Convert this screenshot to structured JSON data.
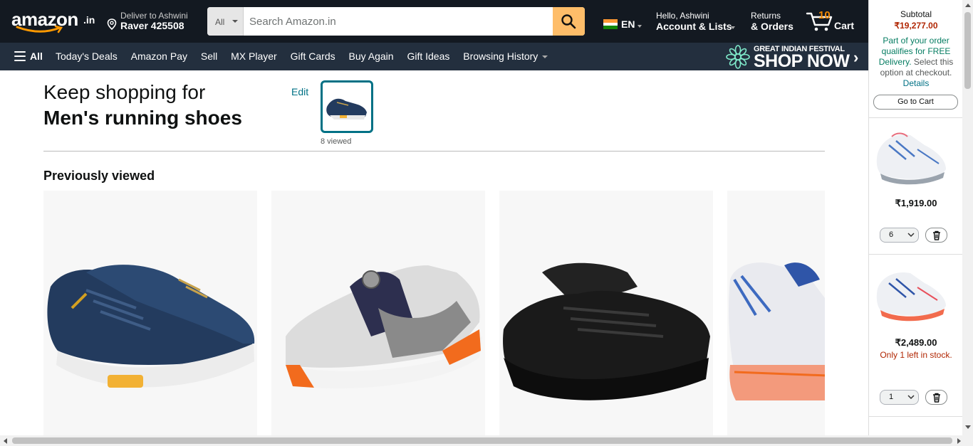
{
  "header": {
    "logo_text": "amazon",
    "logo_suffix": ".in",
    "deliver_line1": "Deliver to Ashwini",
    "deliver_line2": "Raver 425508",
    "search_category": "All",
    "search_placeholder": "Search Amazon.in",
    "search_value": "",
    "language": "EN",
    "account_line1": "Hello, Ashwini",
    "account_line2": "Account & Lists",
    "orders_line1": "Returns",
    "orders_line2": "& Orders",
    "cart_count": "10",
    "cart_label": "Cart"
  },
  "subnav": {
    "all_label": "All",
    "links": [
      "Today's Deals",
      "Amazon Pay",
      "Sell",
      "MX Player",
      "Gift Cards",
      "Buy Again",
      "Gift Ideas",
      "Browsing History"
    ],
    "promo_line1": "GREAT INDIAN FESTIVAL",
    "promo_line2": "SHOP NOW"
  },
  "main": {
    "keep_title": "Keep shopping for",
    "keep_subtitle": "Men's running shoes",
    "edit_label": "Edit",
    "viewed_label": "8 viewed",
    "previously_viewed_title": "Previously viewed",
    "products": [
      {
        "name": "navy-sneaker-image"
      },
      {
        "name": "disc-sneaker-image"
      },
      {
        "name": "black-running-shoe-image"
      },
      {
        "name": "white-orange-sneaker-image"
      }
    ]
  },
  "cart_sidebar": {
    "subtotal_label": "Subtotal",
    "subtotal_value": "₹19,277.00",
    "free_delivery_green": "Part of your order qualifies for FREE Delivery.",
    "free_delivery_rest": "Select this option at checkout.",
    "details_link": "Details",
    "go_to_cart_label": "Go to Cart",
    "items": [
      {
        "price": "₹1,919.00",
        "stock": "",
        "qty": "6"
      },
      {
        "price": "₹2,489.00",
        "stock": "Only 1 left in stock.",
        "qty": "1"
      }
    ]
  },
  "colors": {
    "nav_dark": "#131921",
    "nav_secondary": "#232f3e",
    "search_button": "#febd69",
    "link_teal": "#007185",
    "price_red": "#b12704",
    "cart_count_orange": "#f08804",
    "green": "#067d62"
  },
  "icons": [
    "location-pin-icon",
    "search-icon",
    "cart-icon",
    "hamburger-icon",
    "chevron-down-icon",
    "trash-icon",
    "india-flag-icon"
  ]
}
